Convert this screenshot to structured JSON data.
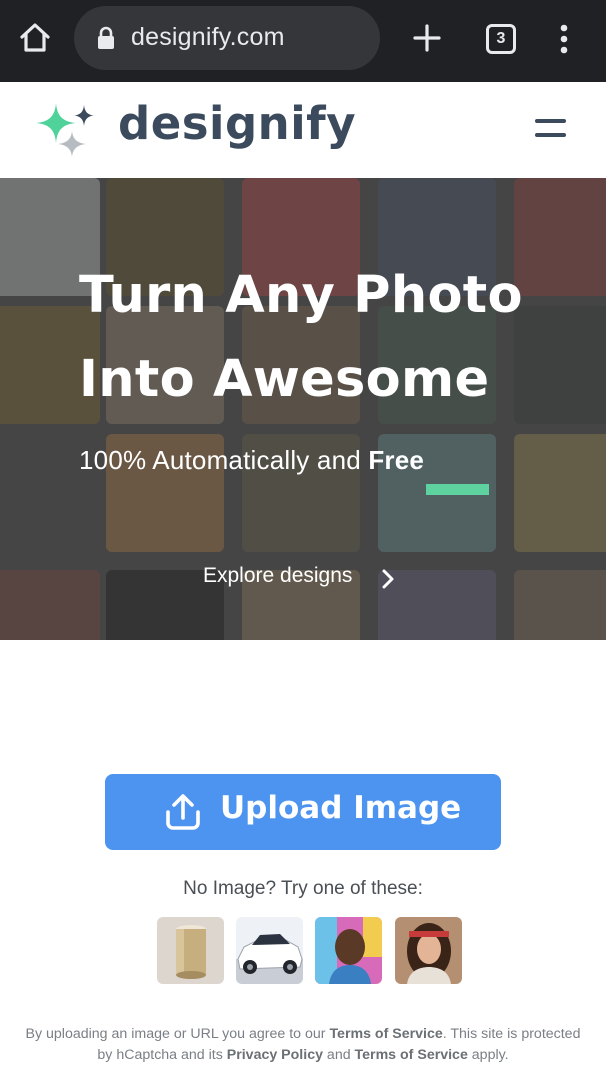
{
  "browser": {
    "url": "designify.com",
    "tab_count": "3"
  },
  "site": {
    "logo_text": "designify"
  },
  "hero": {
    "title_line1": "Turn Any Photo",
    "title_line2": "Into Awesome",
    "subtitle_prefix": "100% Automatically and ",
    "subtitle_emphasis": "Free",
    "explore_label": "Explore designs",
    "accent_color": "#5fd39f"
  },
  "upload": {
    "button_label": "Upload Image",
    "button_color": "#4c94f0",
    "try_text": "No Image? Try one of these:",
    "samples": [
      "bottle",
      "car",
      "man",
      "woman"
    ]
  },
  "legal": {
    "part1": "By uploading an image or URL you agree to our ",
    "terms_link_1": "Terms of Service",
    "part2": ". This site is protected by hCaptcha and its ",
    "privacy_link": "Privacy Policy",
    "part3": " and ",
    "terms_link_2": "Terms of Service",
    "part4": " apply."
  }
}
